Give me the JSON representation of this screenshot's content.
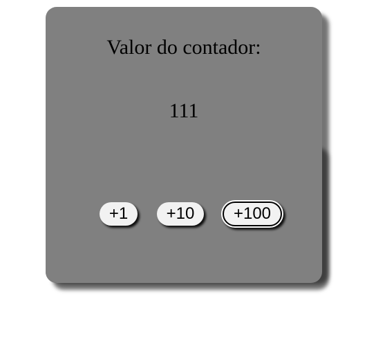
{
  "counter": {
    "label": "Valor do contador:",
    "value": "111"
  },
  "buttons": {
    "plus_one": "+1",
    "plus_ten": "+10",
    "plus_hundred": "+100"
  },
  "colors": {
    "card_background": "#808080",
    "button_background": "#f2f2f2",
    "page_background": "#ffffff"
  }
}
